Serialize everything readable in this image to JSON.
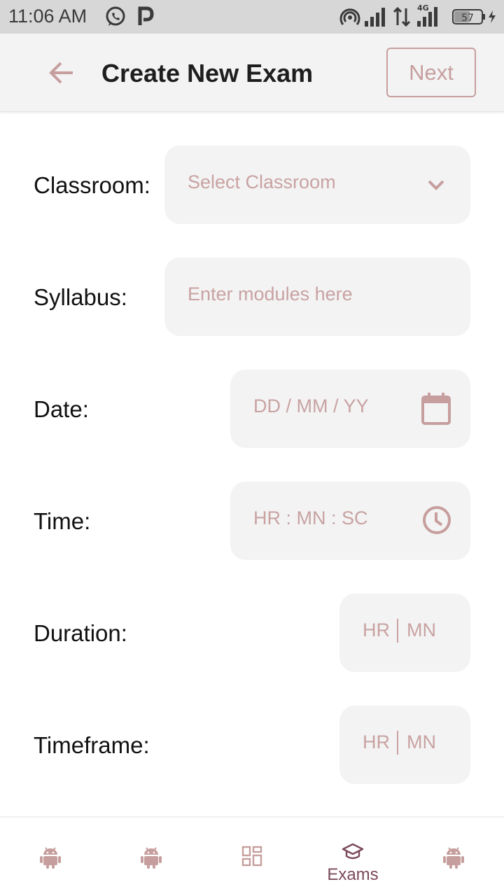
{
  "status_bar": {
    "time": "11:06 AM",
    "battery": "57",
    "network": "4G",
    "icons": [
      "whatsapp-icon",
      "p-app-icon",
      "hotspot-icon",
      "signal-icon",
      "data-arrows-icon",
      "signal-4g-icon",
      "battery-icon",
      "charging-icon"
    ]
  },
  "header": {
    "title": "Create New Exam",
    "next_label": "Next",
    "back_icon": "arrow-left-icon"
  },
  "form": {
    "classroom": {
      "label": "Classroom:",
      "placeholder": "Select Classroom",
      "icon": "chevron-down-icon"
    },
    "syllabus": {
      "label": "Syllabus:",
      "placeholder": "Enter modules here"
    },
    "date": {
      "label": "Date:",
      "placeholder": "DD / MM / YY",
      "icon": "calendar-icon"
    },
    "time": {
      "label": "Time:",
      "placeholder": "HR : MN : SC",
      "icon": "clock-icon"
    },
    "duration": {
      "label": "Duration:",
      "hr": "HR",
      "mn": "MN"
    },
    "timeframe": {
      "label": "Timeframe:",
      "hr": "HR",
      "mn": "MN"
    }
  },
  "bottom_nav": {
    "items": [
      {
        "icon": "android-icon",
        "label": ""
      },
      {
        "icon": "android-icon",
        "label": ""
      },
      {
        "icon": "dashboard-grid-icon",
        "label": ""
      },
      {
        "icon": "graduation-cap-icon",
        "label": "Exams",
        "active": true
      },
      {
        "icon": "android-icon",
        "label": ""
      }
    ]
  },
  "colors": {
    "accent": "#c79e9e",
    "placeholder": "#c9a2a2",
    "field_bg": "#f3f3f3",
    "active_nav": "#7b4a5a",
    "status_bar_bg": "#d7d7d7"
  }
}
